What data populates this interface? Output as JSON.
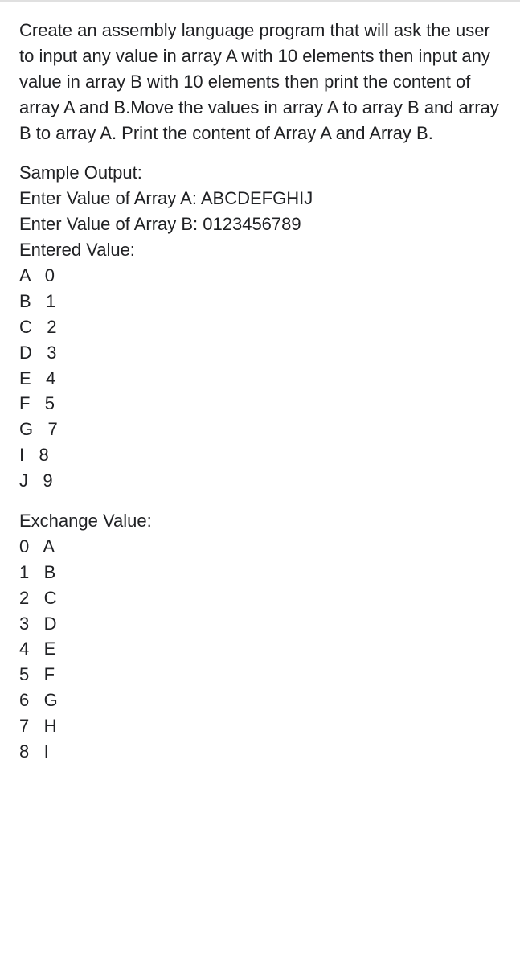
{
  "problem": {
    "description": "Create an assembly language program that will ask the user to input any value in array A with 10 elements then input any value in array B with 10 elements then print the content of array A and B.Move the values in array A to array B and array B to array A. Print the content of Array A and Array B."
  },
  "sample": {
    "heading": "Sample Output:",
    "enterA_label": "Enter Value of Array A: ",
    "enterA_value": "ABCDEFGHIJ",
    "enterB_label": "Enter Value of Array B: ",
    "enterB_value": "0123456789",
    "entered_heading": "Entered Value:",
    "entered_pairs": [
      {
        "a": "A",
        "b": "0"
      },
      {
        "a": "B",
        "b": "1"
      },
      {
        "a": "C",
        "b": "2"
      },
      {
        "a": "D",
        "b": "3"
      },
      {
        "a": "E",
        "b": "4"
      },
      {
        "a": "F",
        "b": "5"
      },
      {
        "a": "G",
        "b": "7"
      },
      {
        "a": "I",
        "b": "8"
      },
      {
        "a": "J",
        "b": "9"
      }
    ],
    "exchange_heading": "Exchange Value:",
    "exchange_pairs": [
      {
        "a": "0",
        "b": "A"
      },
      {
        "a": "1",
        "b": "B"
      },
      {
        "a": "2",
        "b": "C"
      },
      {
        "a": "3",
        "b": "D"
      },
      {
        "a": "4",
        "b": "E"
      },
      {
        "a": "5",
        "b": "F"
      },
      {
        "a": "6",
        "b": "G"
      },
      {
        "a": "7",
        "b": "H"
      },
      {
        "a": "8",
        "b": "I"
      }
    ]
  }
}
